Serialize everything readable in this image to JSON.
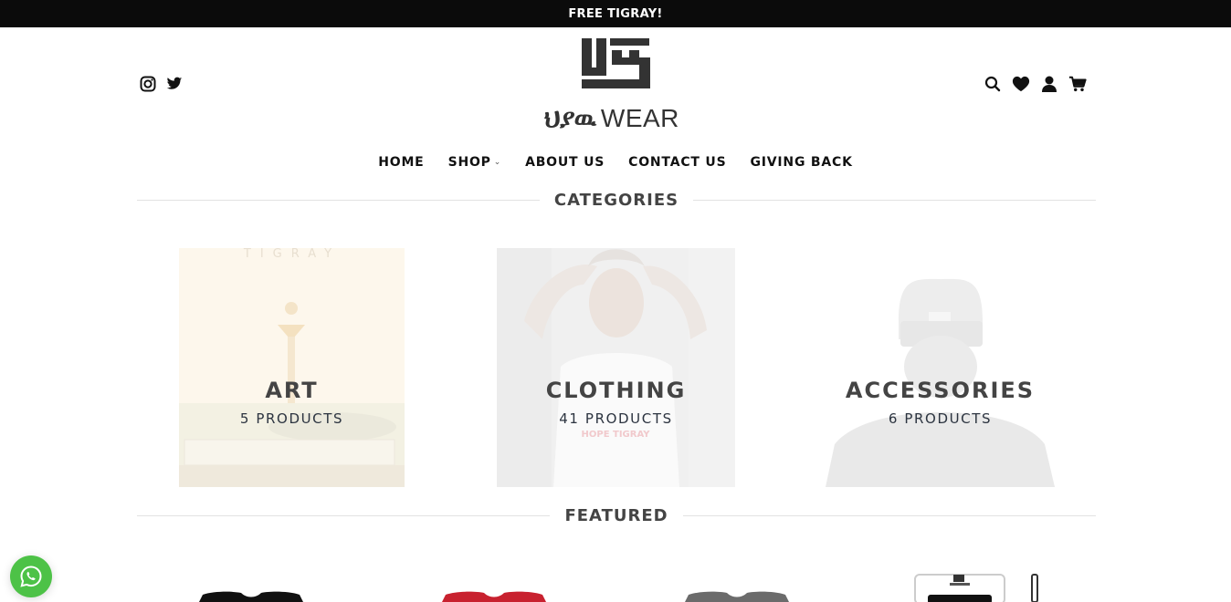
{
  "announcement": "FREE TIGRAY!",
  "brand": {
    "amharic": "ህያዉ",
    "latin": "WEAR"
  },
  "social": {
    "icons": [
      "instagram-icon",
      "twitter-icon"
    ]
  },
  "header_actions": {
    "icons": [
      "search-icon",
      "heart-icon",
      "account-icon",
      "cart-icon"
    ]
  },
  "nav": {
    "items": [
      {
        "label": "HOME"
      },
      {
        "label": "SHOP"
      },
      {
        "label": "ABOUT US"
      },
      {
        "label": "CONTACT US"
      },
      {
        "label": "GIVING BACK"
      }
    ]
  },
  "sections": {
    "categories": "CATEGORIES",
    "featured": "FEATURED"
  },
  "categories": [
    {
      "name": "ART",
      "count": "5 PRODUCTS",
      "image_caption": "TIGRAY"
    },
    {
      "name": "CLOTHING",
      "count": "41 PRODUCTS",
      "image_caption": "HOPE TIGRAY"
    },
    {
      "name": "ACCESSORIES",
      "count": "6 PRODUCTS"
    }
  ],
  "colors": {
    "topbar": "#0b0b0b",
    "whatsapp": "#4dc247",
    "text": "#444444"
  }
}
